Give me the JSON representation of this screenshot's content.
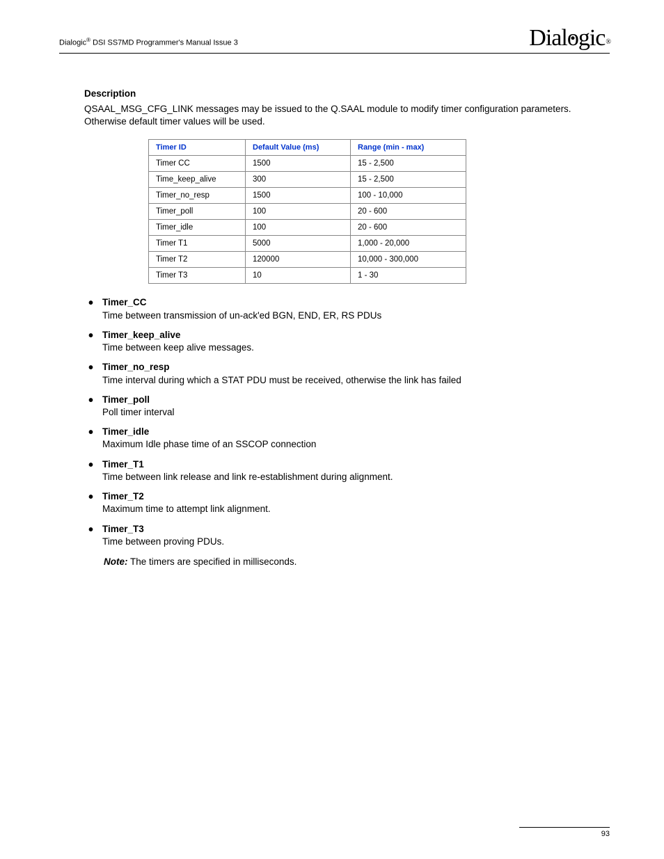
{
  "header": {
    "left_prefix": "Dialogic",
    "left_sup": "®",
    "left_suffix": " DSI SS7MD Programmer's Manual  Issue 3",
    "logo_text": "Dialogic",
    "logo_reg": "®"
  },
  "section": {
    "heading": "Description",
    "paragraph": "QSAAL_MSG_CFG_LINK messages may be issued to the Q.SAAL module to modify timer configuration parameters. Otherwise default timer values will be used."
  },
  "table": {
    "headers": [
      "Timer ID",
      "Default Value (ms)",
      "Range (min - max)"
    ],
    "rows": [
      [
        "Timer CC",
        "1500",
        "15 - 2,500"
      ],
      [
        "Time_keep_alive",
        "300",
        "15 - 2,500"
      ],
      [
        "Timer_no_resp",
        "1500",
        "100 - 10,000"
      ],
      [
        "Timer_poll",
        "100",
        "20 - 600"
      ],
      [
        "Timer_idle",
        "100",
        "20 - 600"
      ],
      [
        "Timer T1",
        "5000",
        "1,000 - 20,000"
      ],
      [
        "Timer T2",
        "120000",
        "10,000 - 300,000"
      ],
      [
        "Timer T3",
        "10",
        "1 - 30"
      ]
    ]
  },
  "definitions": [
    {
      "term": "Timer_CC",
      "desc": "Time between transmission of un-ack'ed BGN, END, ER, RS PDUs"
    },
    {
      "term": "Timer_keep_alive",
      "desc": "Time between keep alive messages."
    },
    {
      "term": "Timer_no_resp",
      "desc": "Time interval during which a STAT PDU must be received, otherwise the link has failed"
    },
    {
      "term": "Timer_poll",
      "desc": "Poll timer interval"
    },
    {
      "term": "Timer_idle",
      "desc": "Maximum Idle phase time of an SSCOP connection"
    },
    {
      "term": "Timer_T1",
      "desc": "Time between link release and link re-establishment during alignment."
    },
    {
      "term": "Timer_T2",
      "desc": "Maximum time to attempt link alignment."
    },
    {
      "term": "Timer_T3",
      "desc": "Time between proving PDUs."
    }
  ],
  "note": {
    "label": "Note:",
    "text": "  The timers are specified in milliseconds."
  },
  "footer": {
    "page_number": "93"
  }
}
